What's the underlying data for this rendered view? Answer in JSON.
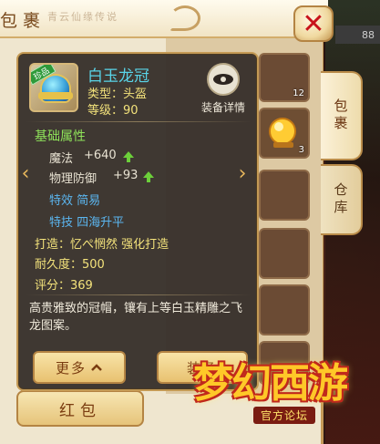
{
  "bag": {
    "title": "包裹",
    "title_decoration": "青云仙缘传说",
    "close_glyph": "✕",
    "top_counter": "88",
    "tabs": [
      {
        "label": "包裹",
        "active": true
      },
      {
        "label": "仓库",
        "active": false
      }
    ],
    "bottom_buttons": [
      {
        "label": "红包"
      }
    ],
    "cell_counts": [
      "12",
      "3"
    ]
  },
  "item": {
    "badge": "珍品",
    "name": "白玉龙冠",
    "type": "类型：头盔",
    "level": "等级：90",
    "detail_button": "装备详情",
    "section_title": "基础属性",
    "stats": [
      {
        "label": "魔法",
        "value": "+640"
      },
      {
        "label": "物理防御",
        "value": "+93"
      }
    ],
    "effect": "特效  简易",
    "skill": "特技  四海升平",
    "forge": "打造：忆ぺ惘然    强化打造",
    "durability": "耐久度：500",
    "score": "评分：369",
    "description": "高贵雅致的冠帽，镶有上等白玉精雕之飞龙图案。",
    "more_button": "更多",
    "equip_button": "装备"
  },
  "logo": {
    "main": "梦幻西游",
    "sub": "官方论坛"
  },
  "colors": {
    "name_cyan": "#59d4e8",
    "attr_yellow": "#f3e27b",
    "section_green": "#8fe35a",
    "special_blue": "#5bb6f0",
    "close_red": "#c8121a"
  }
}
